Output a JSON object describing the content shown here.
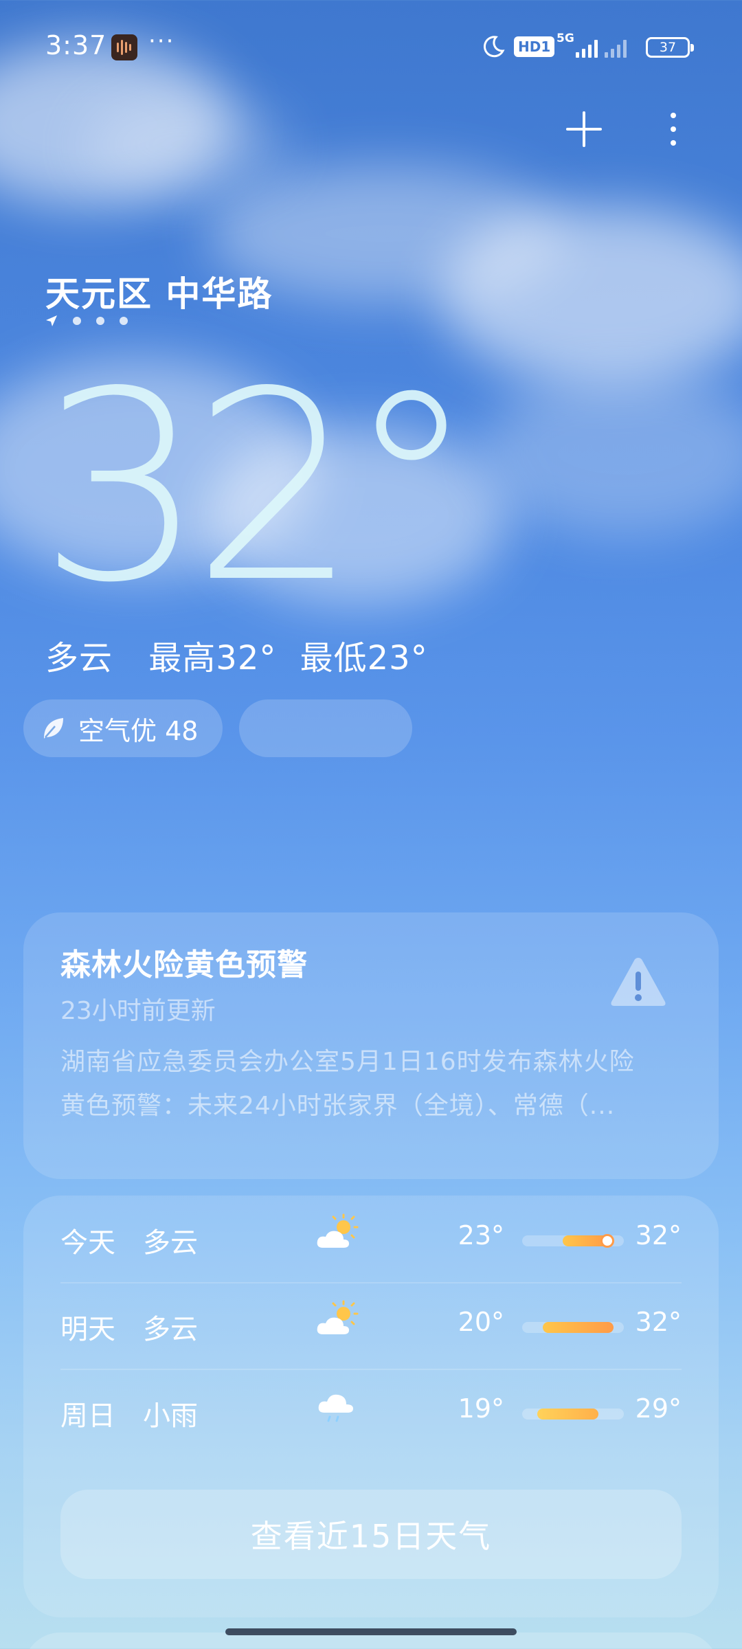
{
  "status_bar": {
    "time": "3:37",
    "more": "···",
    "hd_label": "HD1",
    "network": "5G",
    "battery": "37"
  },
  "header": {
    "location": "天元区 中华路"
  },
  "current": {
    "temperature": "32°",
    "condition": "多云",
    "high": "最高32°",
    "low": "最低23°",
    "aqi": "空气优 48"
  },
  "alert": {
    "title": "森林火险黄色预警",
    "updated": "23小时前更新",
    "body_line1": "湖南省应急委员会办公室5月1日16时发布森林火险",
    "body_line2": "黄色预警：未来24小时张家界（全境）、常德（..."
  },
  "forecast": {
    "days": [
      {
        "day": "今天",
        "condition": "多云",
        "icon": "partly-cloudy-icon",
        "low": "23°",
        "high": "32°",
        "range_start": 0.4,
        "range_end": 0.85,
        "current": 0.85
      },
      {
        "day": "明天",
        "condition": "多云",
        "icon": "partly-cloudy-icon",
        "low": "20°",
        "high": "32°",
        "range_start": 0.2,
        "range_end": 0.9
      },
      {
        "day": "周日",
        "condition": "小雨",
        "icon": "light-rain-icon",
        "low": "19°",
        "high": "29°",
        "range_start": 0.15,
        "range_end": 0.75
      }
    ],
    "cta_label": "查看近15日天气"
  },
  "colors": {
    "accent_bar_start": "#ffc64a",
    "accent_bar_end": "#ff9b48",
    "sky_top": "#3f78cf"
  }
}
